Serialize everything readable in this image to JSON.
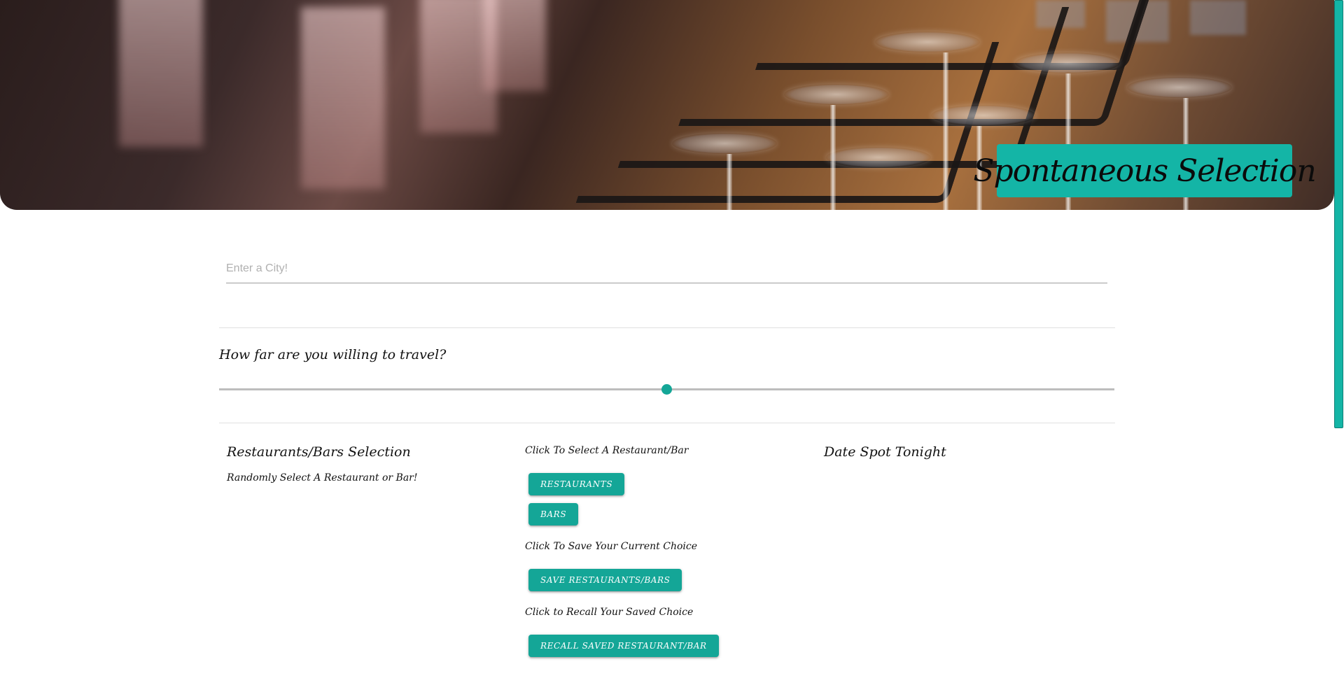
{
  "header": {
    "title": "Spontaneous Selection"
  },
  "search": {
    "placeholder": "Enter a City!",
    "value": ""
  },
  "travel": {
    "heading": "How far are you willing to travel?",
    "slider_level": 0.5
  },
  "selection": {
    "heading": "Restaurants/Bars Selection",
    "subtext": "Randomly Select A Restaurant or Bar!"
  },
  "actions": {
    "select_prompt": "Click To Select A Restaurant/Bar",
    "restaurants_label": "Restaurants",
    "bars_label": "Bars",
    "save_prompt": "Click To Save Your Current Choice",
    "save_label": "Save Restaurants/Bars",
    "recall_prompt": "Click to Recall Your Saved Choice",
    "recall_label": "Recall Saved Restaurant/Bar"
  },
  "result": {
    "heading": "Date Spot Tonight"
  },
  "colors": {
    "accent": "#14a697",
    "badge": "#14b5a6"
  },
  "icons": {
    "hero": "bar-wine-glasses-photo"
  }
}
